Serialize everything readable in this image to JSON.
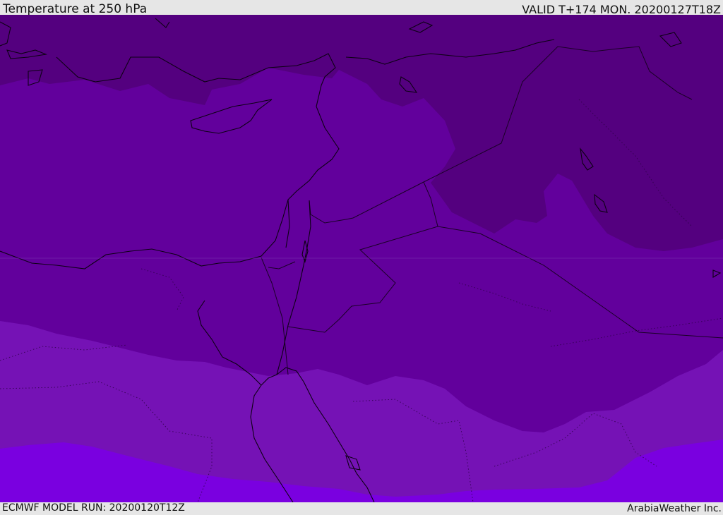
{
  "header": {
    "title": "Temperature at 250 hPa",
    "valid": "VALID T+174 MON. 20200127T18Z"
  },
  "footer": {
    "model_run": "ECMWF MODEL RUN: 20200120T12Z",
    "credit": "ArabiaWeather Inc."
  },
  "colors": {
    "band_coldest": "#54007f",
    "band_cold": "#62009c",
    "band_mid": "#7512b5",
    "band_warm": "#7a00e0",
    "coastline": "#0d0014",
    "frame": "#e6e6e6"
  }
}
